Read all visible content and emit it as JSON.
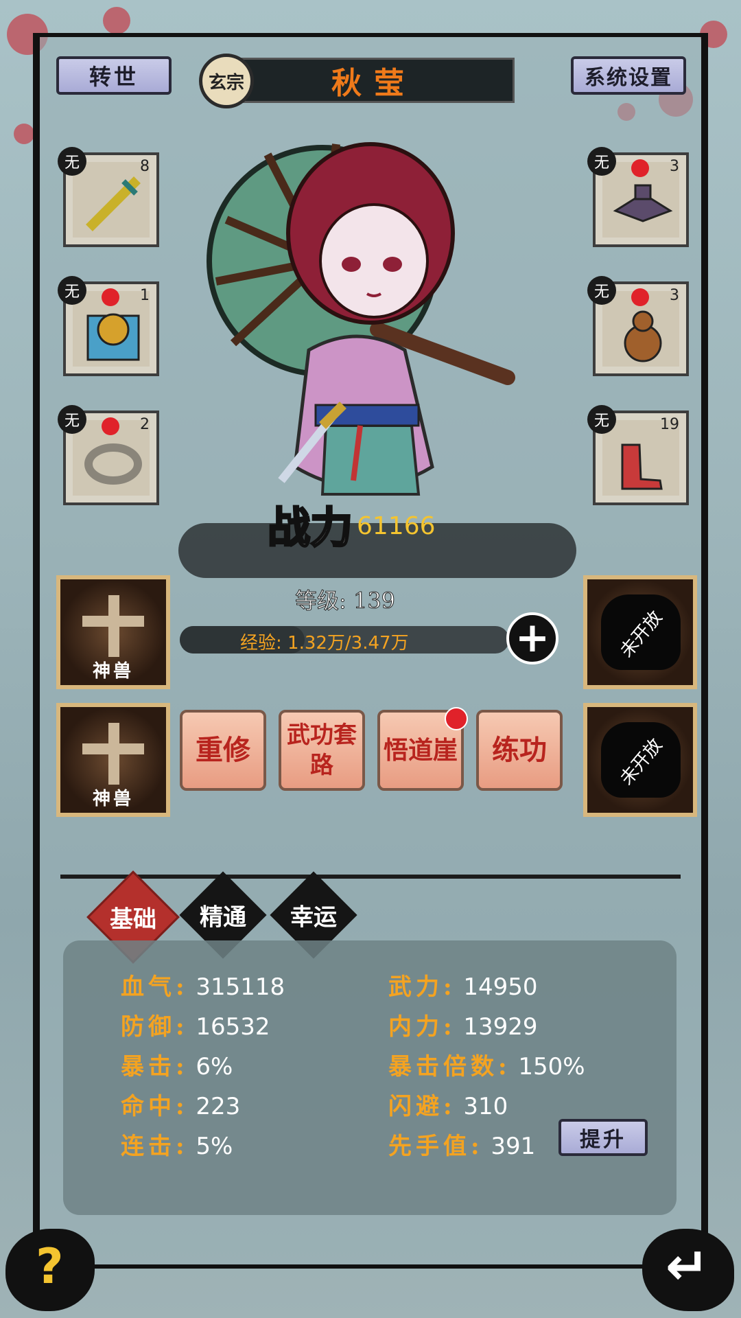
{
  "header": {
    "rebirth_label": "转世",
    "sect_badge": "玄宗",
    "character_name": "秋莹",
    "settings_label": "系统设置"
  },
  "equipment_left": [
    {
      "tag": "无",
      "count": "8",
      "icon": "sword-icon",
      "dot": false
    },
    {
      "tag": "无",
      "count": "1",
      "icon": "armor-icon",
      "dot": true
    },
    {
      "tag": "无",
      "count": "2",
      "icon": "ring-icon",
      "dot": true
    }
  ],
  "equipment_right": [
    {
      "tag": "无",
      "count": "3",
      "icon": "hat-icon",
      "dot": true
    },
    {
      "tag": "无",
      "count": "3",
      "icon": "gourd-icon",
      "dot": true
    },
    {
      "tag": "无",
      "count": "19",
      "icon": "boots-icon",
      "dot": false
    }
  ],
  "power": {
    "label": "战力",
    "value": "61166"
  },
  "level": {
    "label": "等级: 139"
  },
  "exp": {
    "label": "经验: 1.32万/3.47万",
    "progress": 0.38
  },
  "beasts": [
    {
      "label": "神兽"
    },
    {
      "label": "神兽"
    }
  ],
  "locked": [
    {
      "label": "未开放"
    },
    {
      "label": "未开放"
    }
  ],
  "actions": [
    {
      "label": "重修",
      "dot": false
    },
    {
      "label": "武功套路",
      "dot": false
    },
    {
      "label": "悟道崖",
      "dot": true
    },
    {
      "label": "练功",
      "dot": false
    }
  ],
  "tabs": [
    {
      "label": "基础",
      "active": true
    },
    {
      "label": "精通",
      "active": false
    },
    {
      "label": "幸运",
      "active": false
    }
  ],
  "stats_left": [
    {
      "key": "血气:",
      "value": "315118"
    },
    {
      "key": "防御:",
      "value": "16532"
    },
    {
      "key": "暴击:",
      "value": "6%"
    },
    {
      "key": "命中:",
      "value": "223"
    },
    {
      "key": "连击:",
      "value": "5%"
    }
  ],
  "stats_right": [
    {
      "key": "武力:",
      "value": "14950"
    },
    {
      "key": "内力:",
      "value": "13929"
    },
    {
      "key": "暴击倍数:",
      "value": "150%"
    },
    {
      "key": "闪避:",
      "value": "310"
    },
    {
      "key": "先手值:",
      "value": "391"
    }
  ],
  "upgrade_label": "提升",
  "help_label": "?",
  "back_label": "↵",
  "colors": {
    "accent": "#f4a321",
    "name": "#f07a1a",
    "dot": "#e0222a"
  }
}
